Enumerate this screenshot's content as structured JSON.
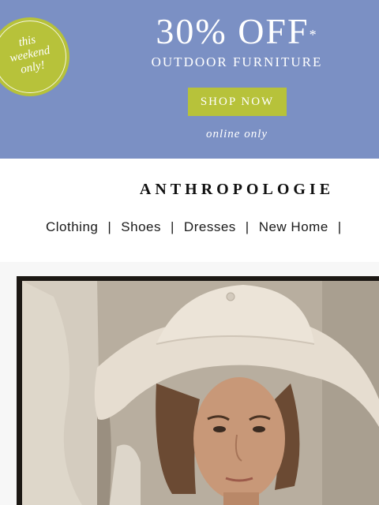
{
  "promo": {
    "badge": [
      "this",
      "weekend",
      "only!"
    ],
    "headline": "30% OFF",
    "asterisk": "*",
    "subhead": "OUTDOOR FURNITURE",
    "cta": "SHOP NOW",
    "note": "online only"
  },
  "brand": "ANTHROPOLOGIE",
  "nav": {
    "items": [
      "Clothing",
      "Shoes",
      "Dresses",
      "New Home"
    ],
    "separator": "|"
  },
  "colors": {
    "promo_bg": "#7b90c4",
    "accent": "#b7c23a"
  }
}
